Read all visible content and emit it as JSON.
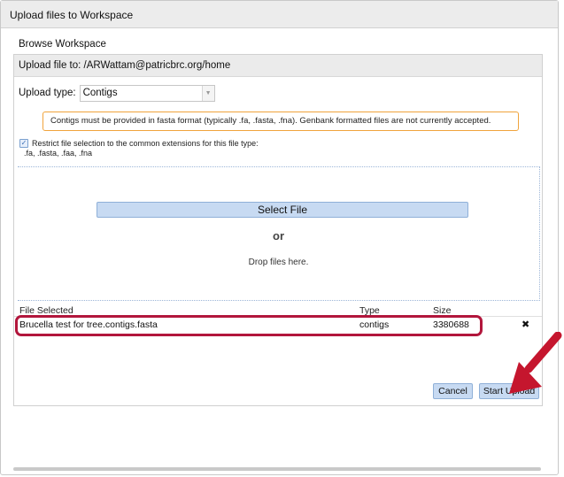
{
  "dialog": {
    "title": "Upload files to Workspace",
    "browse_label": "Browse Workspace"
  },
  "upload": {
    "target_label": "Upload file to: /ARWattam@patricbrc.org/home",
    "type_label": "Upload type:",
    "type_value": "Contigs",
    "notice": "Contigs must be provided in fasta format (typically .fa, .fasta, .fna). Genbank formatted files are not currently accepted.",
    "restrict_label": "Restrict file selection to the common extensions for this file type:",
    "extensions": ".fa, .fasta, .faa, .fna",
    "restrict_checked": true
  },
  "dropzone": {
    "select_button": "Select File",
    "or_text": "or",
    "drop_text": "Drop files here."
  },
  "files_table": {
    "headers": [
      "File Selected",
      "Type",
      "Size"
    ],
    "rows": [
      {
        "name": "Brucella test for tree.contigs.fasta",
        "type": "contigs",
        "size": "3380688"
      }
    ]
  },
  "actions": {
    "cancel": "Cancel",
    "start_upload": "Start Upload"
  },
  "icons": {
    "dropdown": "chevron-down-icon",
    "checkbox": "check-icon",
    "remove": "close-icon",
    "pointer": "arrow-pointer-icon"
  },
  "colors": {
    "highlight": "#b2163c",
    "notice_border": "#f0a43c",
    "button_bg": "#c7daf2",
    "pointer": "#c5162e"
  }
}
